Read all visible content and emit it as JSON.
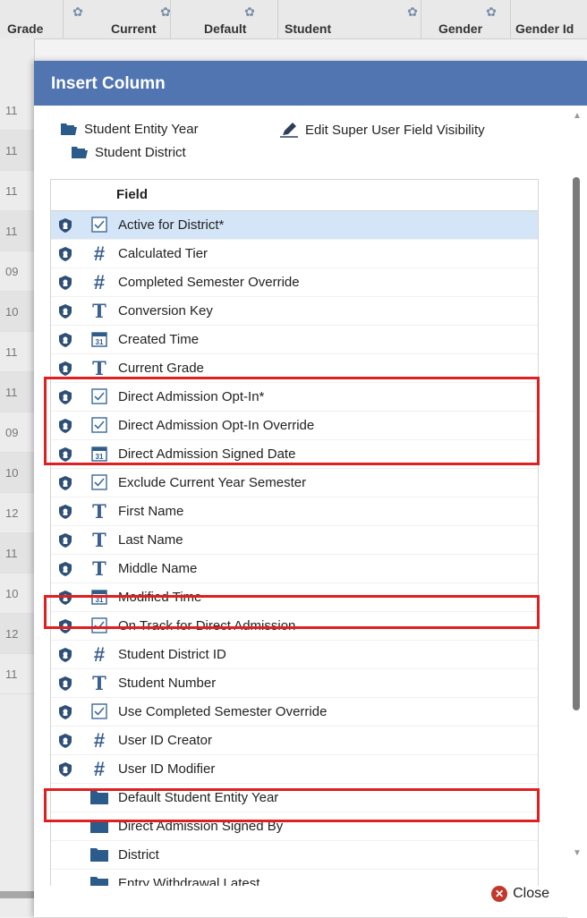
{
  "grid": {
    "headers": [
      "Grade",
      "Current",
      "Default",
      "Student",
      "Gender",
      "Gender Id"
    ],
    "row_values": [
      "11",
      "11",
      "11",
      "11",
      "09",
      "10",
      "11",
      "11",
      "09",
      "10",
      "12",
      "11",
      "10",
      "12",
      "11"
    ]
  },
  "dialog": {
    "title": "Insert Column",
    "links": {
      "student_entity_year": "Student Entity Year",
      "edit_visibility": "Edit Super User Field Visibility",
      "student_district": "Student District"
    },
    "field_header": "Field",
    "fields": [
      {
        "label": "Active for District*",
        "type": "checkbox",
        "shield": true
      },
      {
        "label": "Calculated Tier",
        "type": "number",
        "shield": true
      },
      {
        "label": "Completed Semester Override",
        "type": "number",
        "shield": true
      },
      {
        "label": "Conversion Key",
        "type": "text",
        "shield": true
      },
      {
        "label": "Created Time",
        "type": "date",
        "shield": true
      },
      {
        "label": "Current Grade",
        "type": "text",
        "shield": true
      },
      {
        "label": "Direct Admission Opt-In*",
        "type": "checkbox",
        "shield": true
      },
      {
        "label": "Direct Admission Opt-In Override",
        "type": "checkbox",
        "shield": true
      },
      {
        "label": "Direct Admission Signed Date",
        "type": "date",
        "shield": true
      },
      {
        "label": "Exclude Current Year Semester",
        "type": "checkbox",
        "shield": true
      },
      {
        "label": "First Name",
        "type": "text",
        "shield": true
      },
      {
        "label": "Last Name",
        "type": "text",
        "shield": true
      },
      {
        "label": "Middle Name",
        "type": "text",
        "shield": true
      },
      {
        "label": "Modified Time",
        "type": "date",
        "shield": true
      },
      {
        "label": "On Track for Direct Admission",
        "type": "checkbox",
        "shield": true
      },
      {
        "label": "Student District ID",
        "type": "number",
        "shield": true
      },
      {
        "label": "Student Number",
        "type": "text",
        "shield": true
      },
      {
        "label": "Use Completed Semester Override",
        "type": "checkbox",
        "shield": true
      },
      {
        "label": "User ID Creator",
        "type": "number",
        "shield": true
      },
      {
        "label": "User ID Modifier",
        "type": "number",
        "shield": true
      },
      {
        "label": "Default Student Entity Year",
        "type": "folder",
        "shield": false
      },
      {
        "label": "Direct Admission Signed By",
        "type": "folder",
        "shield": false
      },
      {
        "label": "District",
        "type": "folder",
        "shield": false
      },
      {
        "label": "Entry Withdrawal Latest",
        "type": "folder",
        "shield": false
      }
    ],
    "close_label": "Close"
  },
  "icons": {
    "gear": "gear-icon",
    "folder": "folder-icon",
    "pencil": "pencil-icon",
    "shield": "shield-icon",
    "checkbox": "checkbox-icon",
    "hash": "number-type-icon",
    "text": "text-type-icon",
    "date": "calendar-icon",
    "close": "close-icon"
  },
  "colors": {
    "title_bar": "#5075b0",
    "selected_row": "#d4e5f7",
    "highlight": "#e02020",
    "type_icon": "#2f5d8a"
  }
}
